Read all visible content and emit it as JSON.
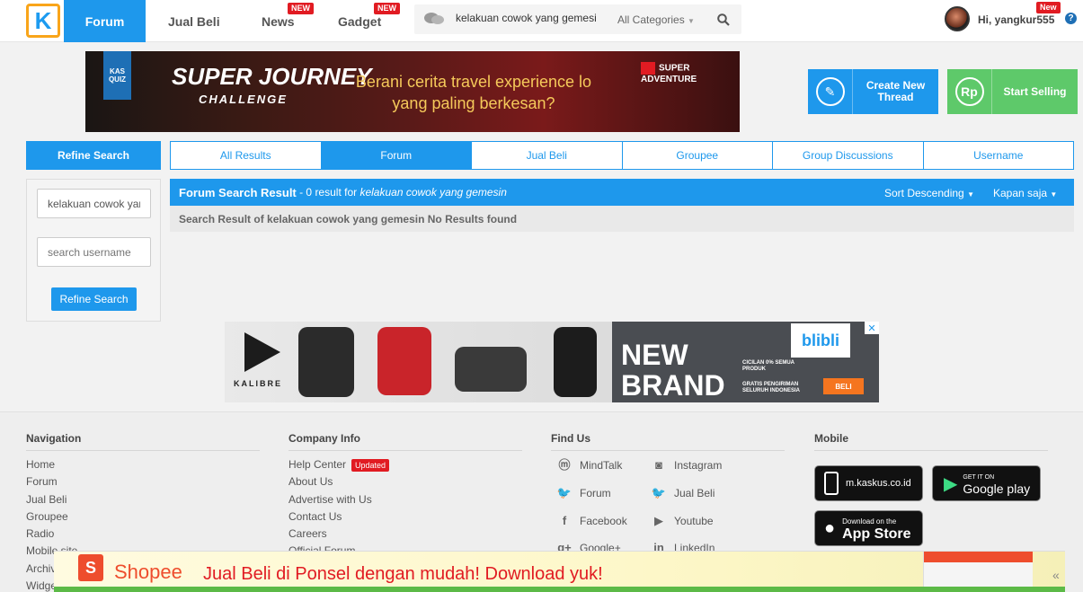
{
  "nav": {
    "logo": "K",
    "items": [
      {
        "label": "Forum",
        "badge": ""
      },
      {
        "label": "Jual Beli",
        "badge": ""
      },
      {
        "label": "News",
        "badge": "NEW"
      },
      {
        "label": "Gadget",
        "badge": "NEW"
      }
    ],
    "search_value": "kelakuan cowok yang gemesin",
    "category": "All Categories",
    "user_greeting": "Hi, yangkur555",
    "user_badge": "New",
    "help": "?"
  },
  "banner": {
    "quiz": "KAS QUIZ",
    "title_line1": "SUPER JOURNEY",
    "title_line2": "CHALLENGE",
    "text": "Berani cerita travel experience lo yang paling berkesan?",
    "brand": "SUPER ADVENTURE"
  },
  "actions": {
    "create_label": "Create New Thread",
    "sell_label": "Start Selling",
    "sell_icon": "Rp"
  },
  "refine": {
    "header": "Refine Search",
    "keyword_value": "kelakuan cowok yang gemesin",
    "username_placeholder": "search username",
    "button": "Refine Search"
  },
  "tabs": [
    "All Results",
    "Forum",
    "Jual Beli",
    "Groupee",
    "Group Discussions",
    "Username"
  ],
  "results": {
    "title": "Forum Search Result",
    "count_text": " - 0 result for ",
    "query": "kelakuan cowok yang gemesin",
    "sort": "Sort Descending",
    "time": "Kapan saja",
    "message": "Search Result of kelakuan cowok yang gemesin No Results found"
  },
  "ad": {
    "brand": "KALIBRE",
    "headline": "NEW BRAND",
    "store": "blibli",
    "promo1": "CICILAN 0% SEMUA PRODUK",
    "promo2": "GRATIS PENGIRIMAN SELURUH INDONESIA",
    "cta": "BELI"
  },
  "footer": {
    "navigation": {
      "title": "Navigation",
      "links": [
        "Home",
        "Forum",
        "Jual Beli",
        "Groupee",
        "Radio",
        "Mobile site",
        "Archive",
        "Widget"
      ]
    },
    "company": {
      "title": "Company Info",
      "links": [
        "Help Center",
        "About Us",
        "Advertise with Us",
        "Contact Us",
        "Careers",
        "Official Forum"
      ],
      "help_badge": "Updated"
    },
    "find_us": {
      "title": "Find Us",
      "left": [
        "MindTalk",
        "Forum",
        "Facebook",
        "Google+"
      ],
      "right": [
        "Instagram",
        "Jual Beli",
        "Youtube",
        "LinkedIn"
      ]
    },
    "mobile": {
      "title": "Mobile",
      "site": "m.kaskus.co.id",
      "gplay_small": "GET IT ON",
      "gplay": "Google play",
      "appstore_small": "Download on the",
      "appstore": "App Store"
    }
  },
  "shopee": {
    "name": "Shopee",
    "message": "Jual Beli di Ponsel dengan mudah! Download yuk!"
  }
}
